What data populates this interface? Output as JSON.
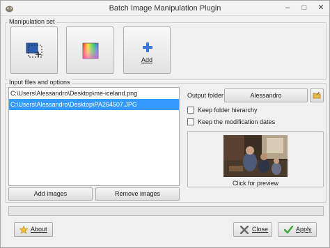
{
  "window": {
    "title": "Batch Image Manipulation Plugin",
    "min_glyph": "–",
    "max_glyph": "□",
    "close_glyph": "✕"
  },
  "manipulation_set": {
    "title": "Manipulation set",
    "add_label": "Add"
  },
  "input": {
    "title": "Input files and options",
    "files": [
      "C:\\Users\\Alessandro\\Desktop\\me-iceland.png",
      "C:\\Users\\Alessandro\\Desktop\\PA264507.JPG"
    ],
    "selected_index": 1,
    "add_images_label": "Add images",
    "remove_images_label": "Remove images"
  },
  "output": {
    "folder_label": "Output folder",
    "folder_value": "Alessandro",
    "keep_hierarchy_label": "Keep folder hierarchy",
    "keep_hierarchy_checked": false,
    "keep_dates_label": "Keep the modification dates",
    "keep_dates_checked": false,
    "preview_label": "Click for preview"
  },
  "progress": {
    "value": 0
  },
  "footer": {
    "about_label": "About",
    "close_label": "Close",
    "apply_label": "Apply"
  },
  "colors": {
    "selection": "#3399ff",
    "progress": "#06b025"
  }
}
